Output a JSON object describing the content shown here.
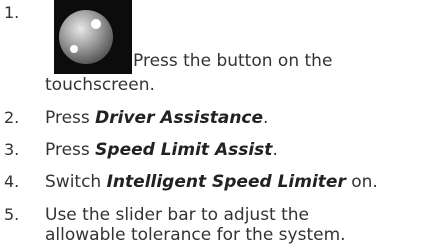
{
  "steps": [
    {
      "number": "1.",
      "icon": "settings-button-icon",
      "text_line1": "Press the button on the",
      "text_line2": "touchscreen."
    },
    {
      "number": "2.",
      "prefix": "Press ",
      "emphasis": "Driver Assistance",
      "suffix": "."
    },
    {
      "number": "3.",
      "prefix": "Press ",
      "emphasis": "Speed Limit Assist",
      "suffix": "."
    },
    {
      "number": "4.",
      "prefix": "Switch ",
      "emphasis": "Intelligent Speed Limiter",
      "suffix": " on."
    },
    {
      "number": "5.",
      "text_line1": "Use the slider bar to adjust the",
      "text_line2": "allowable tolerance for the system."
    }
  ],
  "colors": {
    "text": "#333333",
    "icon_background": "#0c0c0c"
  }
}
